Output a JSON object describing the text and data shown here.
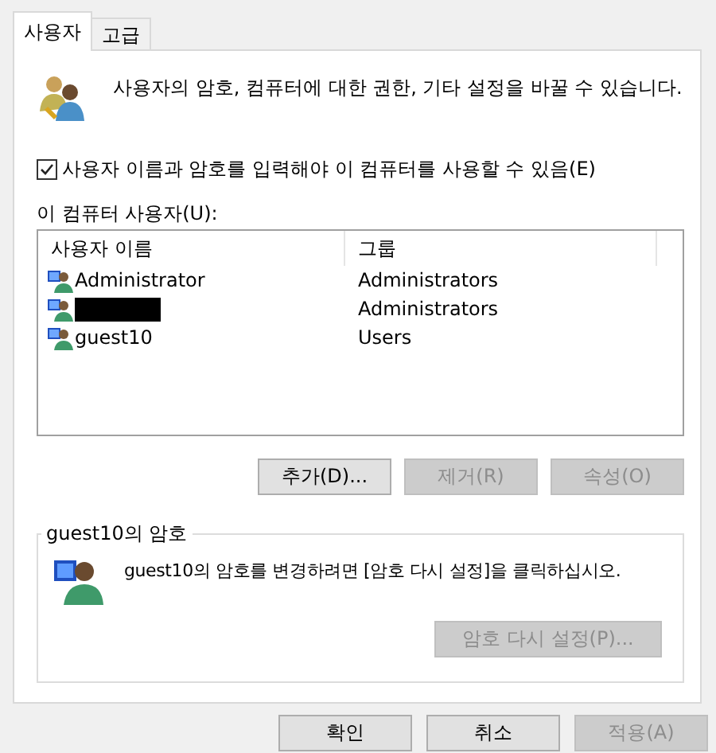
{
  "tabs": [
    {
      "label": "사용자",
      "selected": true
    },
    {
      "label": "고급",
      "selected": false
    }
  ],
  "intro": {
    "text": "사용자의 암호, 컴퓨터에 대한 권한, 기타 설정을 바꿀 수 있습니다."
  },
  "require_login": {
    "label": "사용자 이름과 암호를 입력해야 이 컴퓨터를 사용할 수 있음(E)",
    "checked": true
  },
  "users_label": "이 컴퓨터 사용자(U):",
  "table": {
    "columns": [
      "사용자 이름",
      "그룹"
    ],
    "rows": [
      {
        "name": "Administrator",
        "group": "Administrators",
        "redacted": false
      },
      {
        "group": "Administrators",
        "redacted": true
      },
      {
        "name": "guest10",
        "group": "Users",
        "redacted": false
      }
    ]
  },
  "list_buttons": [
    {
      "label": "추가(D)...",
      "disabled": false
    },
    {
      "label": "제거(R)",
      "disabled": true
    },
    {
      "label": "속성(O)",
      "disabled": true
    }
  ],
  "password_group": {
    "title": "guest10의 암호",
    "text": "guest10의 암호를 변경하려면 [암호 다시 설정]을 클릭하십시오.",
    "button": {
      "label": "암호 다시 설정(P)...",
      "disabled": true
    }
  },
  "footer_buttons": [
    {
      "label": "확인",
      "disabled": false
    },
    {
      "label": "취소",
      "disabled": false
    },
    {
      "label": "적용(A)",
      "disabled": true
    }
  ]
}
